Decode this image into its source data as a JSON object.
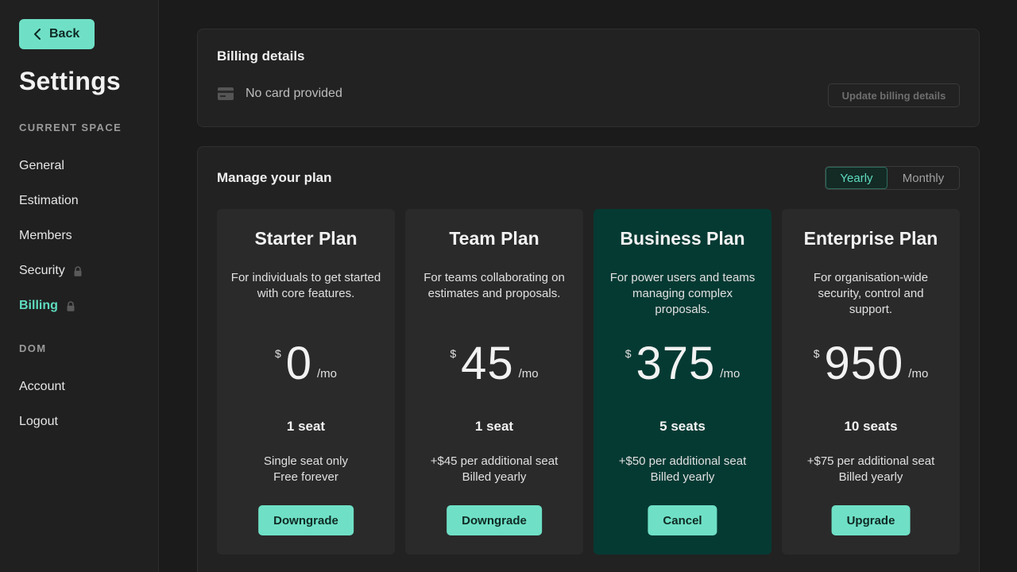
{
  "sidebar": {
    "back_label": "Back",
    "title": "Settings",
    "section_current": "CURRENT SPACE",
    "items": [
      {
        "label": "General"
      },
      {
        "label": "Estimation"
      },
      {
        "label": "Members"
      },
      {
        "label": "Security",
        "locked": true
      },
      {
        "label": "Billing",
        "locked": true,
        "active": true
      }
    ],
    "section_user": "DOM",
    "user_items": [
      {
        "label": "Account"
      },
      {
        "label": "Logout"
      }
    ]
  },
  "billing": {
    "title": "Billing details",
    "card_status": "No card provided",
    "update_label": "Update billing details"
  },
  "plan": {
    "title": "Manage your plan",
    "toggle": {
      "yearly": "Yearly",
      "monthly": "Monthly",
      "selected": "Yearly"
    },
    "plans": [
      {
        "name": "Starter Plan",
        "desc": "For individuals to get started with core features.",
        "currency": "$",
        "amount": "0",
        "period": "/mo",
        "seats": "1 seat",
        "note_1": "Single seat only",
        "note_2": "Free forever",
        "action": "Downgrade"
      },
      {
        "name": "Team Plan",
        "desc": "For teams collaborating on estimates and proposals.",
        "currency": "$",
        "amount": "45",
        "period": "/mo",
        "seats": "1 seat",
        "note_1": "+$45 per additional seat",
        "note_2": "Billed yearly",
        "action": "Downgrade"
      },
      {
        "name": "Business Plan",
        "desc": "For power users and teams managing complex proposals.",
        "currency": "$",
        "amount": "375",
        "period": "/mo",
        "seats": "5 seats",
        "note_1": "+$50 per additional seat",
        "note_2": "Billed yearly",
        "action": "Cancel",
        "current": true
      },
      {
        "name": "Enterprise Plan",
        "desc": "For organisation-wide security, control and support.",
        "currency": "$",
        "amount": "950",
        "period": "/mo",
        "seats": "10 seats",
        "note_1": "+$75 per additional seat",
        "note_2": "Billed yearly",
        "action": "Upgrade"
      }
    ]
  },
  "colors": {
    "accent": "#6fe0c6",
    "active_text": "#5fdcbf",
    "featured_bg": "#053a33",
    "bg": "#1b1b1b"
  }
}
